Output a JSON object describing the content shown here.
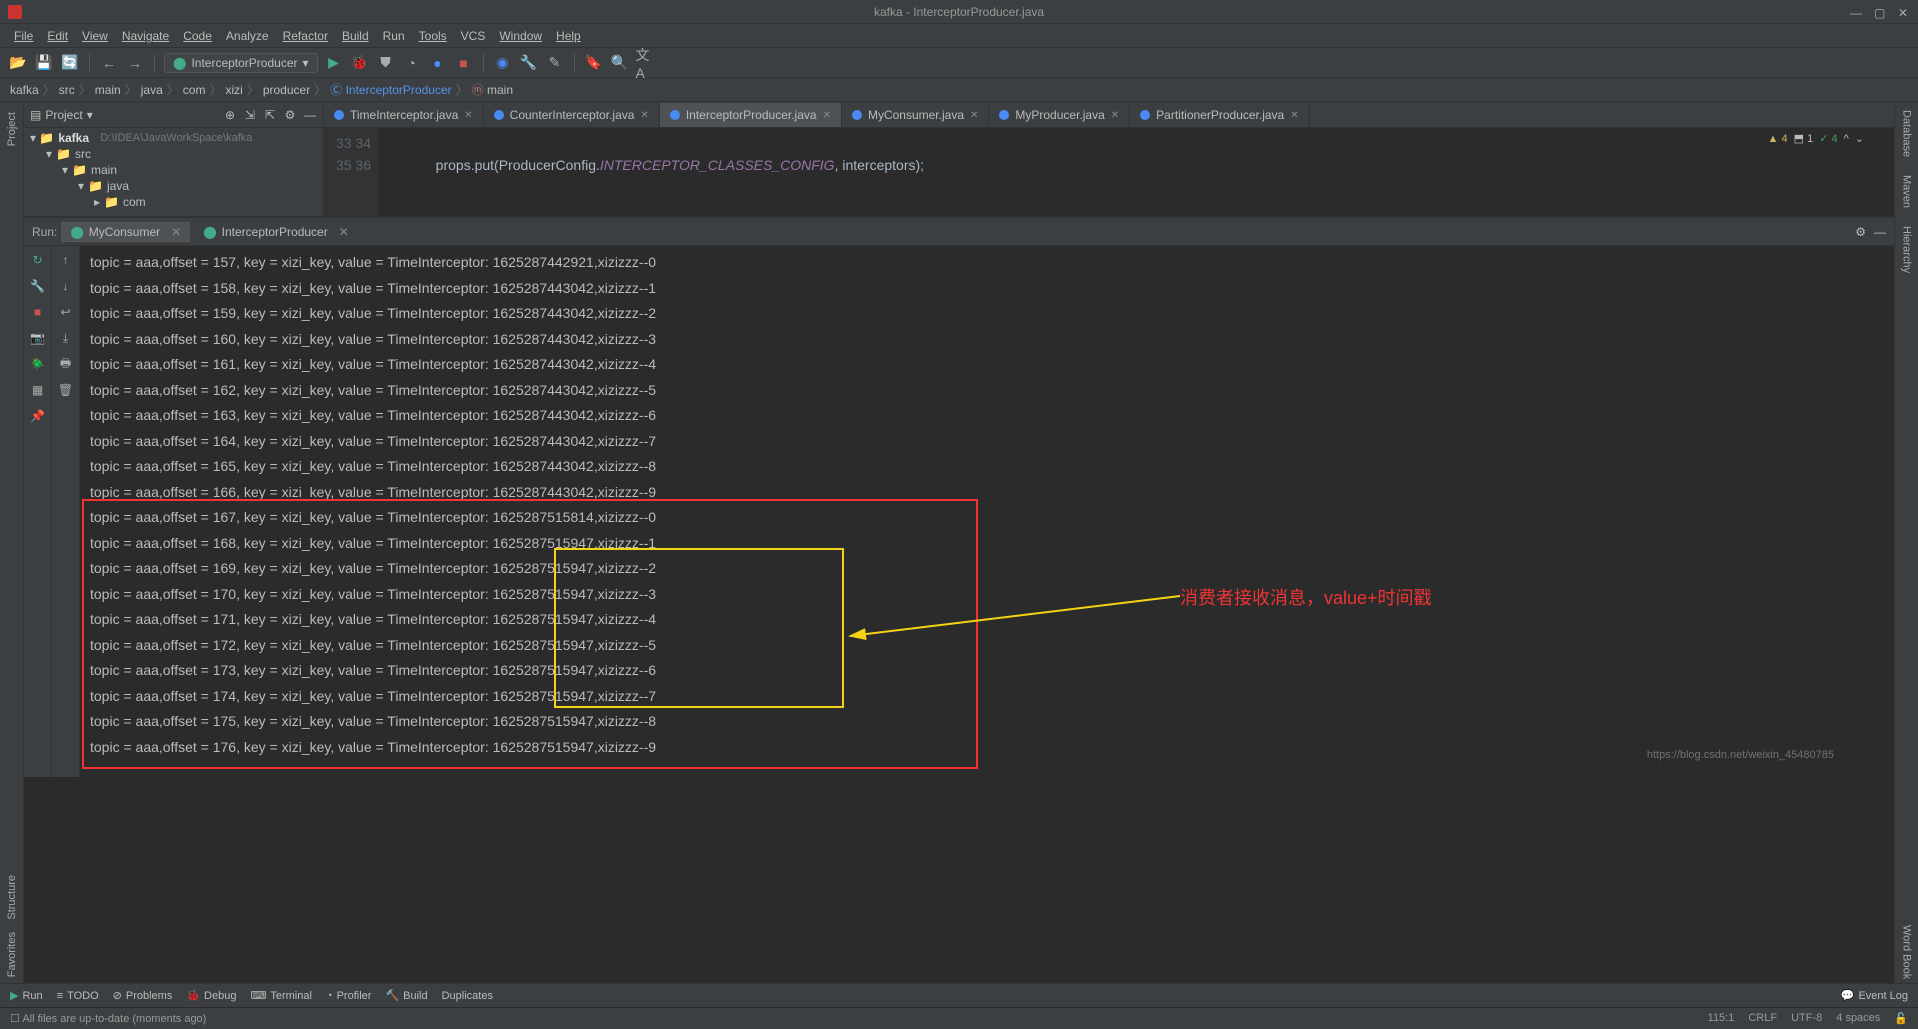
{
  "window": {
    "title": "kafka - InterceptorProducer.java"
  },
  "menubar": [
    "File",
    "Edit",
    "View",
    "Navigate",
    "Code",
    "Analyze",
    "Refactor",
    "Build",
    "Run",
    "Tools",
    "VCS",
    "Window",
    "Help"
  ],
  "toolbar": {
    "run_config": "InterceptorProducer"
  },
  "breadcrumbs": [
    "kafka",
    "src",
    "main",
    "java",
    "com",
    "xizi",
    "producer",
    "InterceptorProducer",
    "main"
  ],
  "project": {
    "header": "Project",
    "root": {
      "name": "kafka",
      "path": "D:\\IDEA\\JavaWorkSpace\\kafka"
    },
    "tree": [
      "src",
      "main",
      "java",
      "com"
    ]
  },
  "editor_tabs": [
    {
      "name": "TimeInterceptor.java",
      "active": false
    },
    {
      "name": "CounterInterceptor.java",
      "active": false
    },
    {
      "name": "InterceptorProducer.java",
      "active": true
    },
    {
      "name": "MyConsumer.java",
      "active": false
    },
    {
      "name": "MyProducer.java",
      "active": false
    },
    {
      "name": "PartitionerProducer.java",
      "active": false
    }
  ],
  "editor": {
    "indicators": {
      "warn": "4",
      "info": "1",
      "ok": "4"
    },
    "lines": {
      "33": "",
      "34": "            props.put(ProducerConfig.INTERCEPTOR_CLASSES_CONFIG, interceptors);",
      "35": "",
      "36": ""
    }
  },
  "run": {
    "label": "Run:",
    "tabs": [
      "MyConsumer",
      "InterceptorProducer"
    ],
    "active_tab": 0
  },
  "console_lines": [
    "topic = aaa,offset = 157, key = xizi_key, value = TimeInterceptor: 1625287442921,xizizzz--0",
    "topic = aaa,offset = 158, key = xizi_key, value = TimeInterceptor: 1625287443042,xizizzz--1",
    "topic = aaa,offset = 159, key = xizi_key, value = TimeInterceptor: 1625287443042,xizizzz--2",
    "topic = aaa,offset = 160, key = xizi_key, value = TimeInterceptor: 1625287443042,xizizzz--3",
    "topic = aaa,offset = 161, key = xizi_key, value = TimeInterceptor: 1625287443042,xizizzz--4",
    "topic = aaa,offset = 162, key = xizi_key, value = TimeInterceptor: 1625287443042,xizizzz--5",
    "topic = aaa,offset = 163, key = xizi_key, value = TimeInterceptor: 1625287443042,xizizzz--6",
    "topic = aaa,offset = 164, key = xizi_key, value = TimeInterceptor: 1625287443042,xizizzz--7",
    "topic = aaa,offset = 165, key = xizi_key, value = TimeInterceptor: 1625287443042,xizizzz--8",
    "topic = aaa,offset = 166, key = xizi_key, value = TimeInterceptor: 1625287443042,xizizzz--9",
    "topic = aaa,offset = 167, key = xizi_key, value = TimeInterceptor: 1625287515814,xizizzz--0",
    "topic = aaa,offset = 168, key = xizi_key, value = TimeInterceptor: 1625287515947,xizizzz--1",
    "topic = aaa,offset = 169, key = xizi_key, value = TimeInterceptor: 1625287515947,xizizzz--2",
    "topic = aaa,offset = 170, key = xizi_key, value = TimeInterceptor: 1625287515947,xizizzz--3",
    "topic = aaa,offset = 171, key = xizi_key, value = TimeInterceptor: 1625287515947,xizizzz--4",
    "topic = aaa,offset = 172, key = xizi_key, value = TimeInterceptor: 1625287515947,xizizzz--5",
    "topic = aaa,offset = 173, key = xizi_key, value = TimeInterceptor: 1625287515947,xizizzz--6",
    "topic = aaa,offset = 174, key = xizi_key, value = TimeInterceptor: 1625287515947,xizizzz--7",
    "topic = aaa,offset = 175, key = xizi_key, value = TimeInterceptor: 1625287515947,xizizzz--8",
    "topic = aaa,offset = 176, key = xizi_key, value = TimeInterceptor: 1625287515947,xizizzz--9"
  ],
  "annotation_text": "消费者接收消息，value+时间戳",
  "bottom_tools": [
    "Run",
    "TODO",
    "Problems",
    "Debug",
    "Terminal",
    "Profiler",
    "Build",
    "Duplicates"
  ],
  "event_log": "Event Log",
  "status": {
    "left": "All files are up-to-date (moments ago)",
    "pos": "115:1",
    "eol": "CRLF",
    "enc": "UTF-8",
    "indent": "4 spaces"
  },
  "watermark": "https://blog.csdn.net/weixin_45480785",
  "side_tools_left": [
    "Project",
    "Structure",
    "Favorites"
  ],
  "side_tools_right": [
    "Database",
    "Maven",
    "Hierarchy",
    "Word Book"
  ]
}
